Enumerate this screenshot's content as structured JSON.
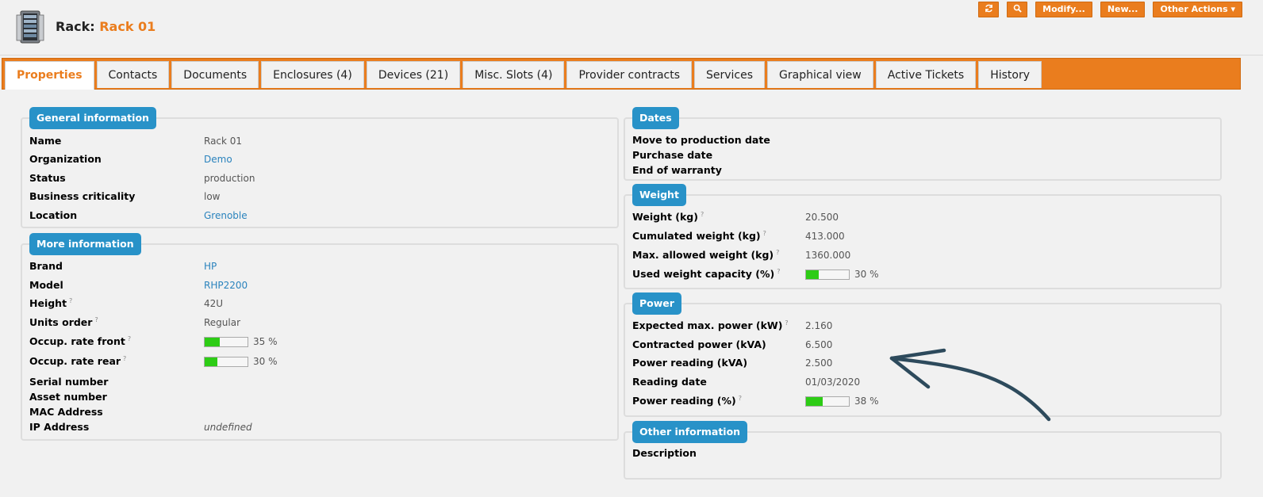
{
  "header": {
    "title_label": "Rack:",
    "title_value": "Rack 01",
    "icon": "rack-icon"
  },
  "actions": {
    "refresh_icon": "refresh-icon",
    "search_icon": "search-icon",
    "modify": "Modify...",
    "new": "New...",
    "other": "Other Actions ▾"
  },
  "tabs": [
    {
      "label": "Properties"
    },
    {
      "label": "Contacts"
    },
    {
      "label": "Documents"
    },
    {
      "label": "Enclosures (4)"
    },
    {
      "label": "Devices (21)"
    },
    {
      "label": "Misc. Slots (4)"
    },
    {
      "label": "Provider contracts"
    },
    {
      "label": "Services"
    },
    {
      "label": "Graphical view"
    },
    {
      "label": "Active Tickets"
    },
    {
      "label": "History"
    }
  ],
  "general": {
    "legend": "General information",
    "rows": [
      {
        "label": "Name",
        "value": "Rack 01"
      },
      {
        "label": "Organization",
        "value": "Demo"
      },
      {
        "label": "Status",
        "value": "production"
      },
      {
        "label": "Business criticality",
        "value": "low"
      },
      {
        "label": "Location",
        "value": "Grenoble"
      }
    ]
  },
  "more": {
    "legend": "More information",
    "rows": [
      {
        "label": "Brand",
        "value": "HP"
      },
      {
        "label": "Model",
        "value": "RHP2200"
      },
      {
        "label": "Height",
        "value": "42U"
      },
      {
        "label": "Units order",
        "value": "Regular"
      },
      {
        "label": "Occup. rate front",
        "value": "35 %",
        "fill": 35
      },
      {
        "label": "Occup. rate rear",
        "value": "30 %",
        "fill": 30
      },
      {
        "label": "Serial number",
        "value": ""
      },
      {
        "label": "Asset number",
        "value": ""
      },
      {
        "label": "MAC Address",
        "value": ""
      },
      {
        "label": "IP Address",
        "value": "undefined"
      }
    ]
  },
  "dates": {
    "legend": "Dates",
    "rows": [
      {
        "label": "Move to production date"
      },
      {
        "label": "Purchase date"
      },
      {
        "label": "End of warranty"
      }
    ]
  },
  "weight": {
    "legend": "Weight",
    "rows": [
      {
        "label": "Weight (kg)",
        "value": "20.500"
      },
      {
        "label": "Cumulated weight (kg)",
        "value": "413.000"
      },
      {
        "label": "Max. allowed weight (kg)",
        "value": "1360.000"
      },
      {
        "label": "Used weight capacity (%)",
        "value": "30 %",
        "fill": 30
      }
    ]
  },
  "power": {
    "legend": "Power",
    "rows": [
      {
        "label": "Expected max. power (kW)",
        "value": "2.160"
      },
      {
        "label": "Contracted power (kVA)",
        "value": "6.500"
      },
      {
        "label": "Power reading (kVA)",
        "value": "2.500"
      },
      {
        "label": "Reading date",
        "value": "01/03/2020"
      },
      {
        "label": "Power reading (%)",
        "value": "38 %",
        "fill": 38
      }
    ]
  },
  "other": {
    "legend": "Other information",
    "rows": [
      {
        "label": "Description"
      }
    ]
  },
  "colors": {
    "accent": "#ea7d1e",
    "legend": "#2892c8",
    "link": "#2a83bd",
    "bar_fill": "#2dcc15",
    "arrow": "#2d4a5c"
  }
}
